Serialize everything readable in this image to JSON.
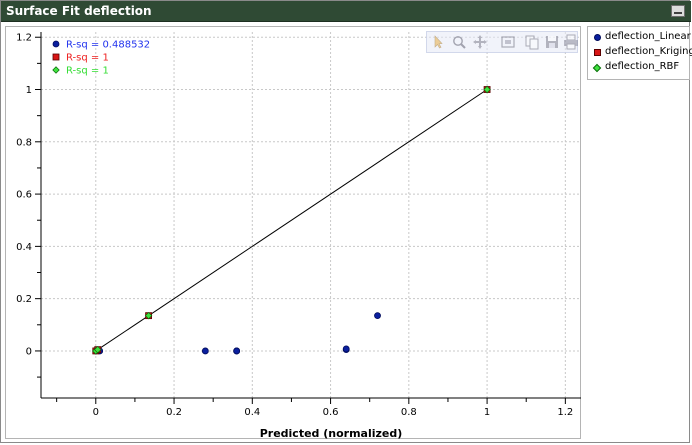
{
  "window": {
    "title": "Surface Fit deflection"
  },
  "colors": {
    "linear": "#0a1f9e",
    "kriging": "#d81515",
    "rbf": "#3fe23f",
    "rsq_linear": "#2233ee",
    "rsq_kriging": "#ee2020",
    "rsq_rbf": "#33dd33"
  },
  "toolbar": {
    "icons": [
      "pointer-icon",
      "zoom-icon",
      "pan-icon",
      "fit-view-icon",
      "copy-icon",
      "save-icon",
      "print-icon"
    ]
  },
  "legend": {
    "items": [
      {
        "label": "deflection_Linear",
        "marker": "circle"
      },
      {
        "label": "deflection_Kriging",
        "marker": "square"
      },
      {
        "label": "deflection_RBF",
        "marker": "diamond"
      }
    ]
  },
  "rsq": [
    {
      "text": "R-sq = 0.488532",
      "marker": "circle"
    },
    {
      "text": "R-sq = 1",
      "marker": "square"
    },
    {
      "text": "R-sq = 1",
      "marker": "diamond"
    }
  ],
  "chart_data": {
    "type": "scatter",
    "title": "",
    "xlabel": "Predicted (normalized)",
    "ylabel": "",
    "xlim": [
      -0.14,
      1.24
    ],
    "ylim": [
      -0.18,
      1.22
    ],
    "x_ticks": [
      0,
      0.2,
      0.4,
      0.6,
      0.8,
      1,
      1.2
    ],
    "x_tick_labels": [
      "0",
      "0.2",
      "0.4",
      "0.6",
      "0.8",
      "1",
      "1.2"
    ],
    "y_ticks": [
      0,
      0.2,
      0.4,
      0.6,
      0.8,
      1,
      1.2
    ],
    "y_tick_labels": [
      "0",
      "0.2",
      "0.4",
      "0.6",
      "0.8",
      "1",
      "1.2"
    ],
    "grid": true,
    "legend_position": "right",
    "reference_line": {
      "x": [
        0,
        1
      ],
      "y": [
        0,
        1
      ]
    },
    "series": [
      {
        "name": "deflection_Linear",
        "marker": "circle",
        "x": [
          0.0,
          0.01,
          0.28,
          0.36,
          0.36,
          0.64,
          0.64,
          0.72
        ],
        "y": [
          0.0,
          0.0,
          0.0,
          0.0,
          0.0,
          0.005,
          0.008,
          0.135
        ]
      },
      {
        "name": "deflection_Kriging",
        "marker": "square",
        "x": [
          0.0,
          0.005,
          0.135,
          1.0
        ],
        "y": [
          0.0,
          0.005,
          0.135,
          1.0
        ]
      },
      {
        "name": "deflection_RBF",
        "marker": "diamond",
        "x": [
          0.0,
          0.005,
          0.135,
          1.0
        ],
        "y": [
          0.0,
          0.005,
          0.135,
          1.0
        ]
      }
    ]
  }
}
